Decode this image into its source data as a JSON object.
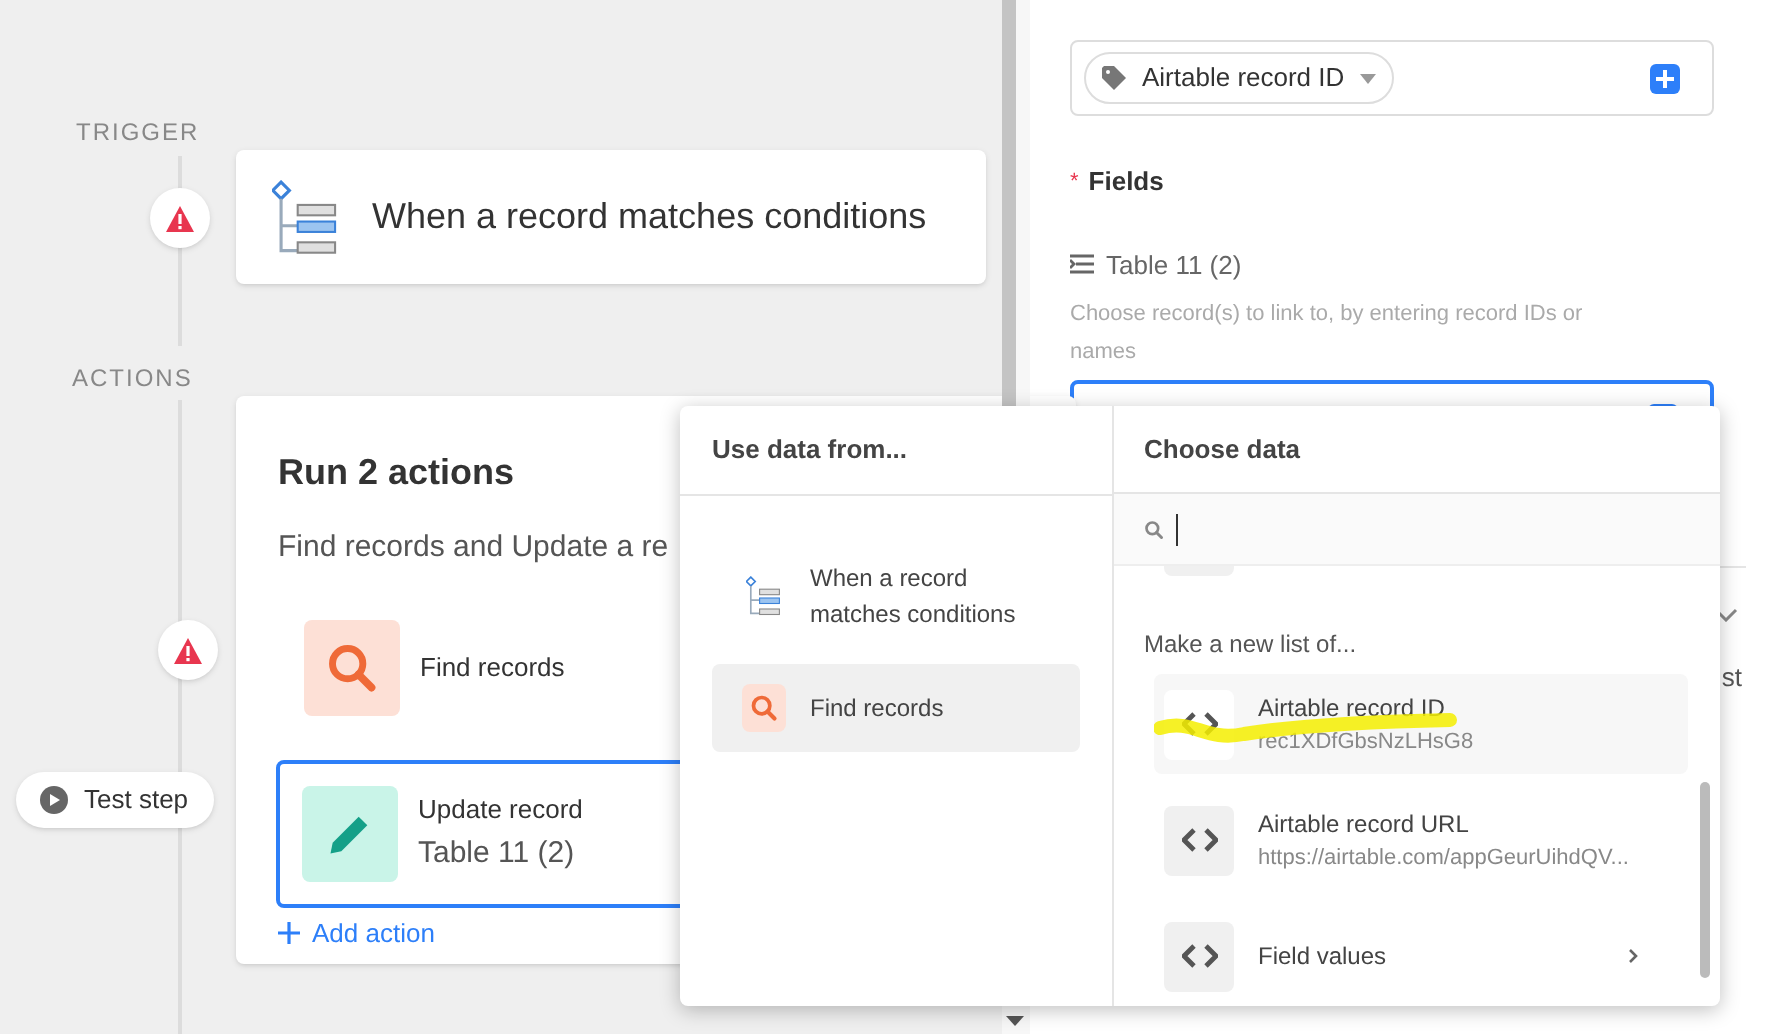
{
  "trigger_section": {
    "label": "TRIGGER",
    "warning": true,
    "card": {
      "title": "When a record matches conditions"
    }
  },
  "actions_section": {
    "label": "ACTIONS",
    "warning": true,
    "test_step": "Test step",
    "card": {
      "title": "Run 2 actions",
      "description": "Find records and Update a re",
      "add_action": "Add action",
      "steps": [
        {
          "kind": "find",
          "title": "Find records",
          "selected": false
        },
        {
          "kind": "update",
          "title": "Update record",
          "subtitle": "Table 11 (2)",
          "selected": true
        }
      ]
    }
  },
  "config_panel": {
    "record_id_chip": "Airtable record ID",
    "fields_label": "Fields",
    "required": true,
    "required_mark": "*",
    "field": {
      "label": "Table 11 (2)",
      "help": "Choose record(s) to link to, by entering record IDs or names",
      "focused": true
    },
    "hidden_text": "st"
  },
  "data_picker": {
    "sources_title": "Use data from...",
    "sources": [
      {
        "kind": "trigger",
        "label": "When a record matches conditions",
        "selected": false
      },
      {
        "kind": "find",
        "label": "Find records",
        "selected": true
      }
    ],
    "choose_title": "Choose data",
    "section_label": "Make a new list of...",
    "options": [
      {
        "label": "Airtable record ID",
        "value": "rec1XDfGbsNzLHsG8",
        "marked": true,
        "hovered": true,
        "submenu": false
      },
      {
        "label": "Airtable record URL",
        "value": "https://airtable.com/appGeurUihdQV...",
        "marked": false,
        "hovered": false,
        "submenu": false
      },
      {
        "label": "Field values",
        "marked": false,
        "hovered": false,
        "submenu": true
      }
    ]
  }
}
